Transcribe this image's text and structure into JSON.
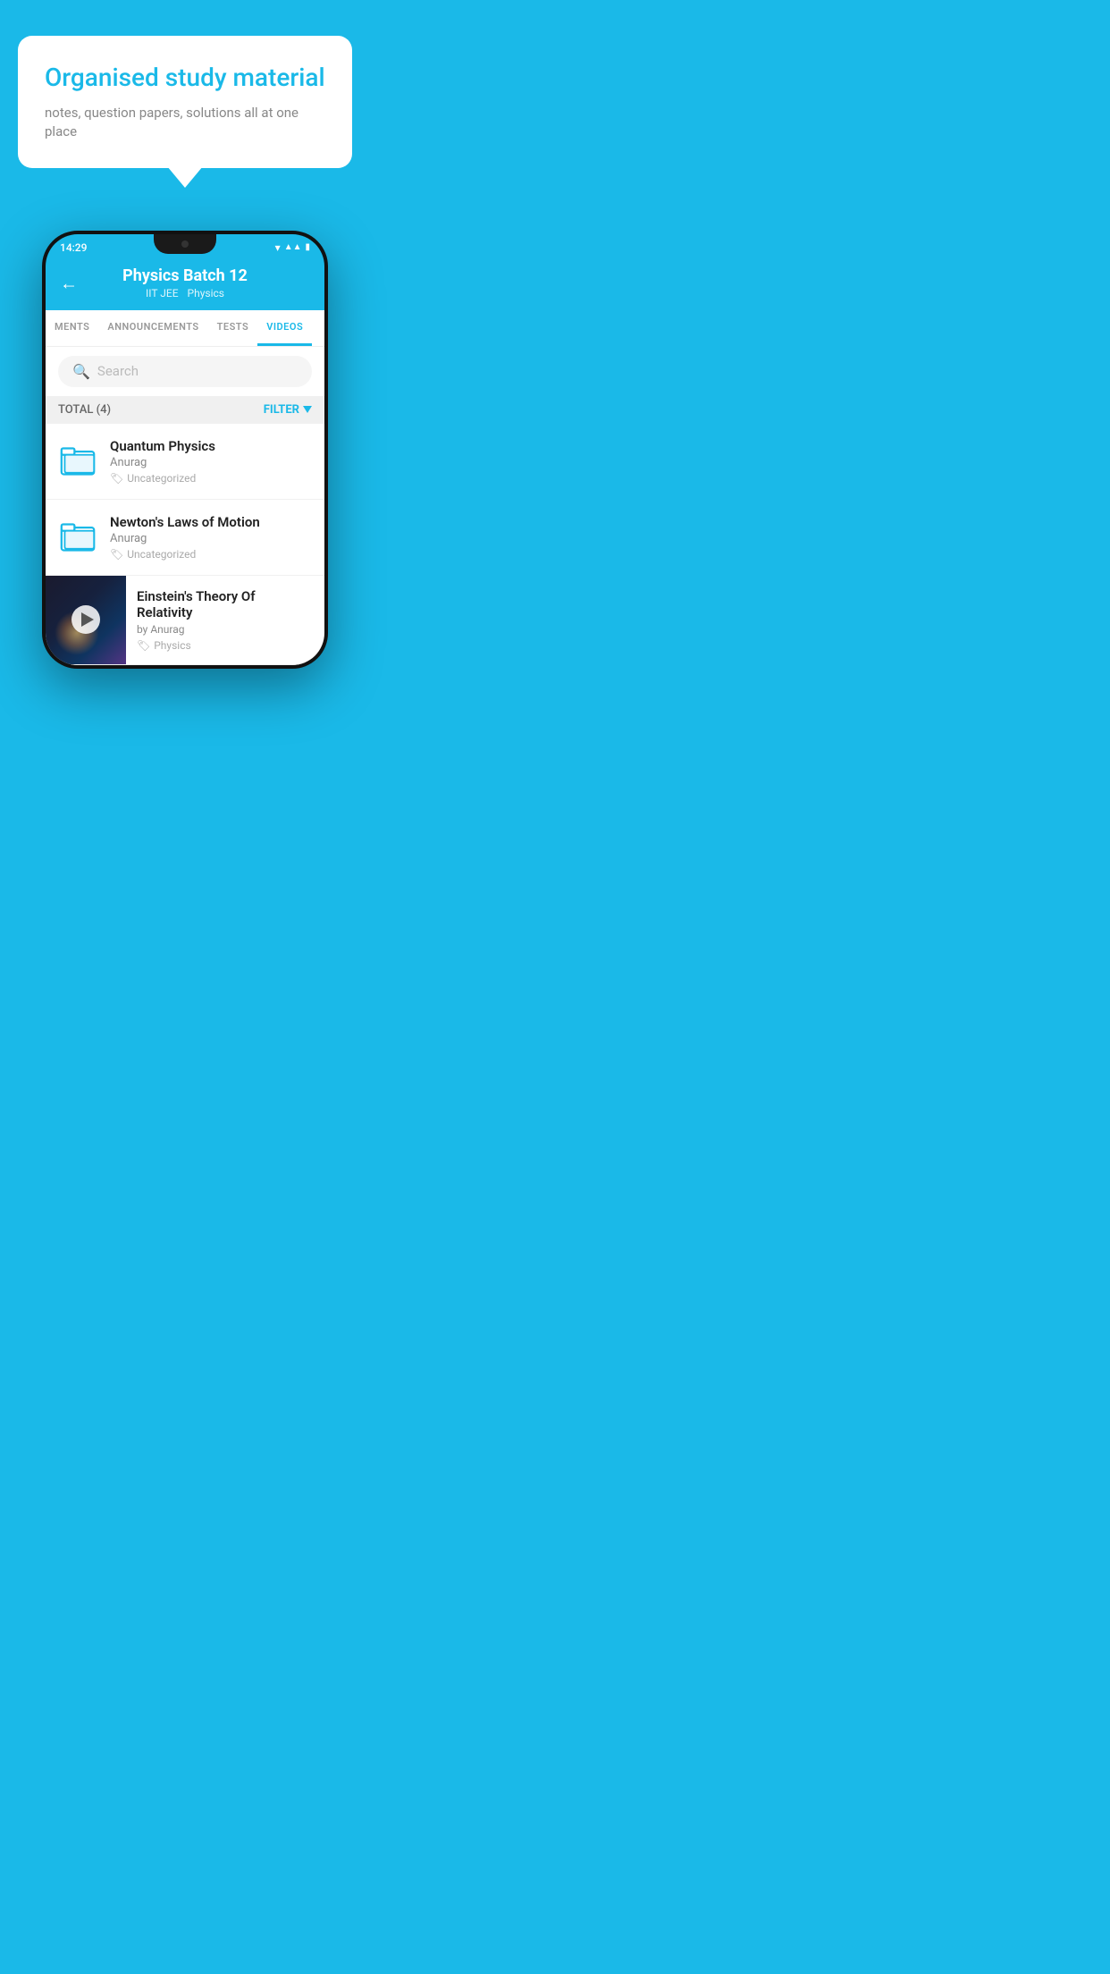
{
  "top": {
    "bubble": {
      "title": "Organised study material",
      "subtitle": "notes, question papers, solutions all at one place"
    }
  },
  "phone": {
    "status": {
      "time": "14:29"
    },
    "header": {
      "title": "Physics Batch 12",
      "subtitle1": "IIT JEE",
      "subtitle2": "Physics",
      "back_icon": "←"
    },
    "tabs": [
      {
        "label": "MENTS",
        "active": false
      },
      {
        "label": "ANNOUNCEMENTS",
        "active": false
      },
      {
        "label": "TESTS",
        "active": false
      },
      {
        "label": "VIDEOS",
        "active": true
      }
    ],
    "search": {
      "placeholder": "Search"
    },
    "filter_bar": {
      "total_label": "TOTAL (4)",
      "filter_label": "FILTER"
    },
    "videos": [
      {
        "id": 1,
        "title": "Quantum Physics",
        "author": "Anurag",
        "tag": "Uncategorized",
        "type": "folder"
      },
      {
        "id": 2,
        "title": "Newton's Laws of Motion",
        "author": "Anurag",
        "tag": "Uncategorized",
        "type": "folder"
      },
      {
        "id": 3,
        "title": "Einstein's Theory Of Relativity",
        "author": "by Anurag",
        "tag": "Physics",
        "type": "video"
      }
    ]
  }
}
